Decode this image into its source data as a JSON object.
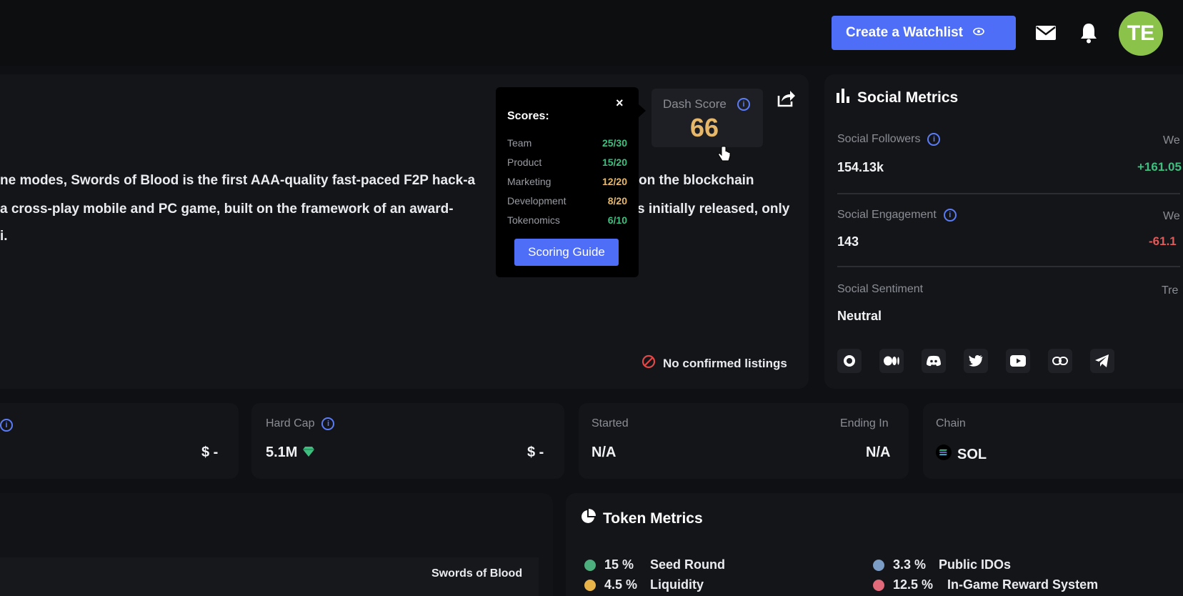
{
  "header": {
    "watchlist_button": "Create a Watchlist",
    "avatar_initials": "TE"
  },
  "description": {
    "lines": [
      "ne modes, Swords of Blood is the first AAA-quality fast-paced F2P hack-a",
      " a cross-play mobile and PC game, built on the framework of an award-",
      "i."
    ],
    "lines_right": [
      "on the blockchain",
      "s initially released, only"
    ]
  },
  "dash_score": {
    "label": "Dash Score",
    "value": "66"
  },
  "scores_popup": {
    "title": "Scores:",
    "close": "×",
    "rows": [
      {
        "name": "Team",
        "value": "25/30",
        "color": "#3fbf7f"
      },
      {
        "name": "Product",
        "value": "15/20",
        "color": "#3fbf7f"
      },
      {
        "name": "Marketing",
        "value": "12/20",
        "color": "#e8b86a"
      },
      {
        "name": "Development",
        "value": "8/20",
        "color": "#e8b86a"
      },
      {
        "name": "Tokenomics",
        "value": "6/10",
        "color": "#3fbf7f"
      }
    ],
    "guide_button": "Scoring Guide"
  },
  "listings": {
    "text": "No confirmed listings"
  },
  "social_metrics": {
    "title": "Social Metrics",
    "followers": {
      "label": "Social Followers",
      "value": "154.13k",
      "right_label": "We",
      "change": "+161.05",
      "change_color": "#3fbf7f"
    },
    "engagement": {
      "label": "Social Engagement",
      "value": "143",
      "right_label": "We",
      "change": "-61.1",
      "change_color": "#e05a5a"
    },
    "sentiment": {
      "label": "Social Sentiment",
      "value": "Neutral",
      "right_label": "Tre"
    }
  },
  "stats": {
    "first": {
      "value": "$ -"
    },
    "hard_cap": {
      "label": "Hard Cap",
      "value": "5.1M",
      "right_value": "$ -"
    },
    "started": {
      "label": "Started",
      "value": "N/A"
    },
    "ending": {
      "label": "Ending In",
      "value": "N/A"
    },
    "chain": {
      "label": "Chain",
      "value": "SOL"
    }
  },
  "bottom_left": {
    "name": "Swords of Blood"
  },
  "token_metrics": {
    "title": "Token Metrics",
    "items": [
      {
        "pct": "15 %",
        "label": "Seed Round",
        "color": "#4caf7d"
      },
      {
        "pct": "4.5 %",
        "label": "Liquidity",
        "color": "#e8b44a"
      },
      {
        "pct": "3.3 %",
        "label": "Public IDOs",
        "color": "#7b9cc4"
      },
      {
        "pct": "12.5 %",
        "label": "In-Game Reward System",
        "color": "#e06a7a"
      }
    ]
  }
}
